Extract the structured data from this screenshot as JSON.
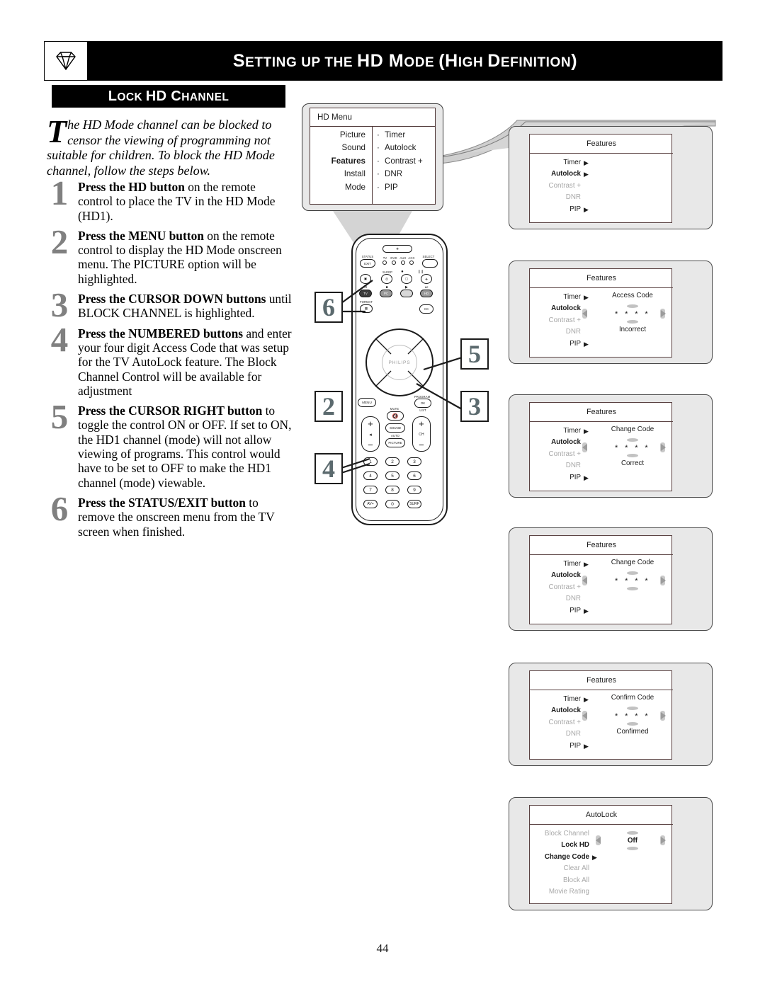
{
  "header": {
    "title_parts": [
      "S",
      "ETTING UP THE ",
      "HD M",
      "ODE ",
      "(H",
      "IGH ",
      "D",
      "EFINITION",
      ")"
    ],
    "title": "SETTING UP THE HD MODE (HIGH DEFINITION)",
    "logo_icon": "diamond-gem-icon"
  },
  "section": {
    "title": "LOCK HD CHANNEL"
  },
  "intro": {
    "dropcap": "T",
    "text": "he HD Mode channel can be blocked to censor the viewing of programming not suitable for children. To block the HD Mode channel, follow the steps below."
  },
  "steps": [
    {
      "num": "1",
      "bold": "Press the HD button",
      "rest": " on the remote control to place the TV in the HD Mode (HD1)."
    },
    {
      "num": "2",
      "bold": "Press the MENU button",
      "rest": " on the remote control to display the HD Mode onscreen menu. The PICTURE option will be highlighted."
    },
    {
      "num": "3",
      "bold": "Press the CURSOR DOWN buttons",
      "rest": " until BLOCK CHANNEL is highlighted."
    },
    {
      "num": "4",
      "bold": "Press the NUMBERED buttons",
      "rest": " and enter your four digit Access Code that was setup for the TV AutoLock feature. The Block Channel Control will be available for adjustment"
    },
    {
      "num": "5",
      "bold": "Press the CURSOR RIGHT button",
      "rest": " to toggle the control ON or OFF. If set to ON, the HD1 channel (mode) will not allow viewing of programs. This control would have to be set to OFF to make the HD1 channel (mode) viewable."
    },
    {
      "num": "6",
      "bold": "Press the STATUS/EXIT button",
      "rest": " to remove the onscreen menu from the TV screen when finished."
    }
  ],
  "tv_menu": {
    "title": "HD Menu",
    "left_items": [
      {
        "label": "Picture",
        "bold": false
      },
      {
        "label": "Sound",
        "bold": false
      },
      {
        "label": "Features",
        "bold": true
      },
      {
        "label": "Install",
        "bold": false
      },
      {
        "label": "Mode",
        "bold": false
      }
    ],
    "right_items": [
      "Timer",
      "Autolock",
      "Contrast +",
      "DNR",
      "PIP"
    ]
  },
  "remote": {
    "brand": "PHILIPS",
    "labels": {
      "status": "STATUS",
      "exit": "EXIT",
      "select": "SELECT",
      "sources": [
        "TV",
        "DVD",
        "AUX",
        "ACC"
      ],
      "sleep": "SLEEP",
      "format": "FORMAT",
      "cc": "CC",
      "menu": "MENU",
      "mute": "MUTE",
      "sound": "SOUND",
      "auto": "AUTO",
      "picture": "PICTURE",
      "program": "PROGRAM",
      "ok": "OK",
      "list": "LIST",
      "ch": "CH",
      "tv": "TV",
      "pc": "PC",
      "hd": "HD",
      "av": "AV+",
      "surf": "SURF",
      "digits": [
        "1",
        "2",
        "3",
        "4",
        "5",
        "6",
        "7",
        "8",
        "9",
        "0"
      ]
    }
  },
  "callouts": [
    {
      "num": "6"
    },
    {
      "num": "5"
    },
    {
      "num": "2"
    },
    {
      "num": "3"
    },
    {
      "num": "4"
    }
  ],
  "panels": [
    {
      "title": "Features",
      "items": [
        {
          "label": "Timer",
          "state": "normal",
          "arrow": true
        },
        {
          "label": "Autolock",
          "state": "bold",
          "arrow": true
        },
        {
          "label": "Contrast +",
          "state": "dim",
          "arrow": false
        },
        {
          "label": "DNR",
          "state": "dim",
          "arrow": false
        },
        {
          "label": "PIP",
          "state": "normal",
          "arrow": true
        }
      ],
      "control": null
    },
    {
      "title": "Features",
      "items": [
        {
          "label": "Timer",
          "state": "normal",
          "arrow": true
        },
        {
          "label": "Autolock",
          "state": "bold",
          "arrow": false
        },
        {
          "label": "Contrast +",
          "state": "dim",
          "arrow": false
        },
        {
          "label": "DNR",
          "state": "dim",
          "arrow": false
        },
        {
          "label": "PIP",
          "state": "normal",
          "arrow": true
        }
      ],
      "control": {
        "heading": "Access Code",
        "value": "* * * *",
        "status": "Incorrect"
      }
    },
    {
      "title": "Features",
      "items": [
        {
          "label": "Timer",
          "state": "normal",
          "arrow": true
        },
        {
          "label": "Autolock",
          "state": "bold",
          "arrow": false
        },
        {
          "label": "Contrast +",
          "state": "dim",
          "arrow": false
        },
        {
          "label": "DNR",
          "state": "dim",
          "arrow": false
        },
        {
          "label": "PIP",
          "state": "normal",
          "arrow": true
        }
      ],
      "control": {
        "heading": "Change Code",
        "value": "* * * *",
        "status": "Correct"
      }
    },
    {
      "title": "Features",
      "items": [
        {
          "label": "Timer",
          "state": "normal",
          "arrow": true
        },
        {
          "label": "Autolock",
          "state": "bold",
          "arrow": false
        },
        {
          "label": "Contrast +",
          "state": "dim",
          "arrow": false
        },
        {
          "label": "DNR",
          "state": "dim",
          "arrow": false
        },
        {
          "label": "PIP",
          "state": "normal",
          "arrow": true
        }
      ],
      "control": {
        "heading": "Change Code",
        "value": "* * * *",
        "status": ""
      }
    },
    {
      "title": "Features",
      "items": [
        {
          "label": "Timer",
          "state": "normal",
          "arrow": true
        },
        {
          "label": "Autolock",
          "state": "bold",
          "arrow": false
        },
        {
          "label": "Contrast +",
          "state": "dim",
          "arrow": false
        },
        {
          "label": "DNR",
          "state": "dim",
          "arrow": false
        },
        {
          "label": "PIP",
          "state": "normal",
          "arrow": true
        }
      ],
      "control": {
        "heading": "Confirm Code",
        "value": "* * * *",
        "status": "Confirmed"
      }
    },
    {
      "title": "AutoLock",
      "items": [
        {
          "label": "Block Channel",
          "state": "dim",
          "arrow": false
        },
        {
          "label": "Lock HD",
          "state": "bold",
          "arrow": false
        },
        {
          "label": "Change Code",
          "state": "bold",
          "arrow": true
        },
        {
          "label": "Clear All",
          "state": "dim",
          "arrow": false
        },
        {
          "label": "Block All",
          "state": "dim",
          "arrow": false
        },
        {
          "label": "Movie Rating",
          "state": "dim",
          "arrow": false
        }
      ],
      "control": {
        "heading": "",
        "value": "Off",
        "status": ""
      }
    }
  ],
  "page_number": "44"
}
